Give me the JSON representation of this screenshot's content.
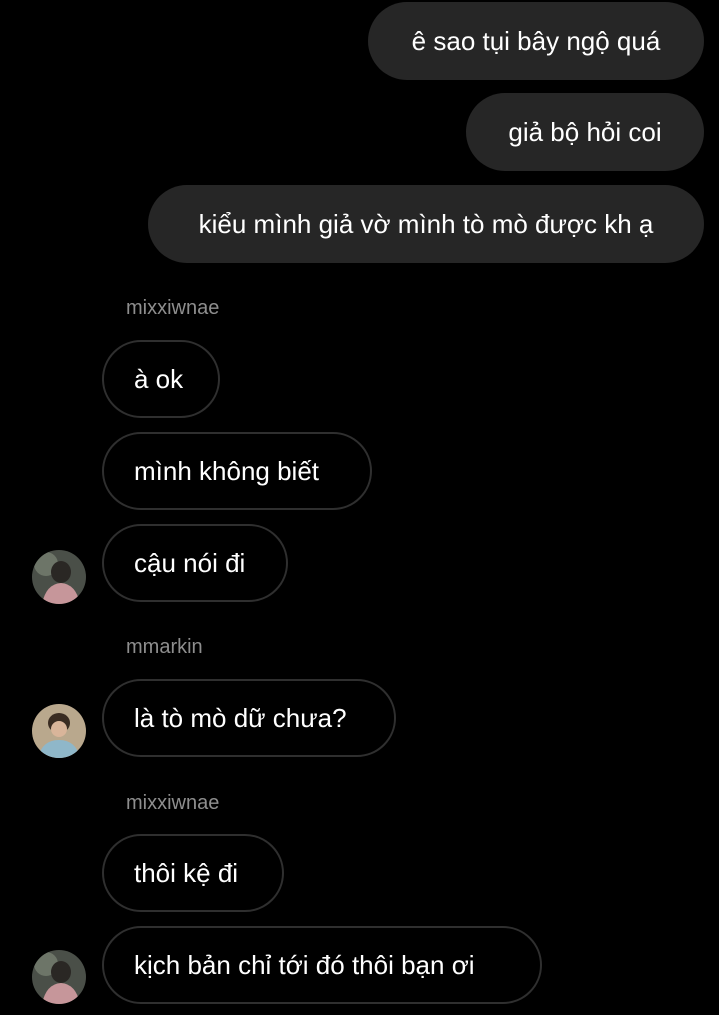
{
  "outgoing": [
    "ê sao tụi bây ngộ quá",
    "giả bộ hỏi coi",
    "kiểu mình giả vờ mình tò mò được kh ạ"
  ],
  "senders": {
    "first": "mixxiwnae",
    "second": "mmarkin",
    "third": "mixxiwnae"
  },
  "incoming": [
    "à ok",
    "mình không biết",
    "cậu nói đi",
    "là tò mò dữ chưa?",
    "thôi kệ đi",
    "kịch bản chỉ tới đó thôi bạn ơi"
  ],
  "avatars": [
    {
      "user": "mixxiwnae",
      "icon": "user-avatar-icon"
    },
    {
      "user": "mmarkin",
      "icon": "user-avatar-icon"
    },
    {
      "user": "mixxiwnae",
      "icon": "user-avatar-icon"
    }
  ],
  "colors": {
    "background": "#000000",
    "outgoing_bubble": "#262626",
    "incoming_border": "#2f2f2f",
    "sender_name": "#8e8e8e",
    "text": "#ffffff"
  }
}
